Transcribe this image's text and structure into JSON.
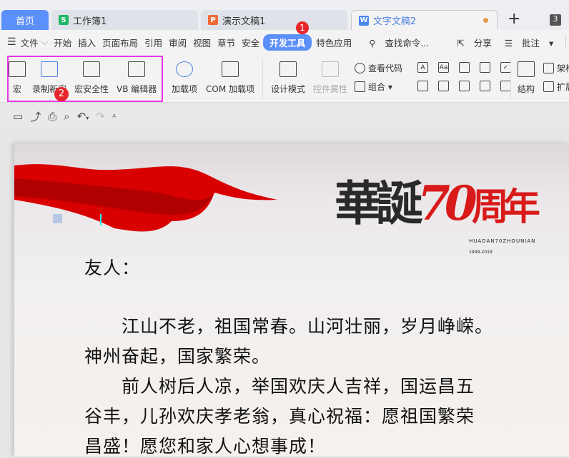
{
  "tabs": [
    {
      "label": "首页"
    },
    {
      "label": "工作簿1",
      "icon": "S"
    },
    {
      "label": "演示文稿1",
      "icon": "P"
    },
    {
      "label": "文字文稿2",
      "icon": "W"
    }
  ],
  "tab_count": "3",
  "menu": {
    "items": [
      "文件",
      "开始",
      "插入",
      "页面布局",
      "引用",
      "审阅",
      "视图",
      "章节",
      "安全",
      "开发工具",
      "特色应用"
    ],
    "search": "查找命令...",
    "share": "分享",
    "comment": "批注",
    "help": "?"
  },
  "ribbon": {
    "macro": "宏",
    "record": "录制新宏",
    "security": "宏安全性",
    "vb": "VB 编辑器",
    "addins": "加载项",
    "com": "COM 加载项",
    "design": "设计模式",
    "props": "控件属性",
    "viewcode": "查看代码",
    "group": "组合",
    "structure": "结构",
    "frame": "架构",
    "expand": "扩展"
  },
  "badges": {
    "one": "1",
    "two": "2"
  },
  "colors": {
    "accent": "#5b8ff9",
    "highlight": "#e836e8",
    "badge": "#e8262a"
  },
  "banner": {
    "title": "華誕70周年",
    "subtitle": "HUADAN70ZHOUNIAN",
    "years": "1949-2019"
  },
  "document": {
    "lines": [
      "友人：",
      "　　江山不老，祖国常春。山河壮丽，岁月峥嵘。",
      "神州奋起，国家繁荣。",
      "　　前人树后人凉，举国欢庆人吉祥，国运昌五",
      "谷丰，儿孙欢庆孝老翁，真心祝福：愿祖国繁荣",
      "昌盛！愿您和家人心想事成！"
    ]
  }
}
